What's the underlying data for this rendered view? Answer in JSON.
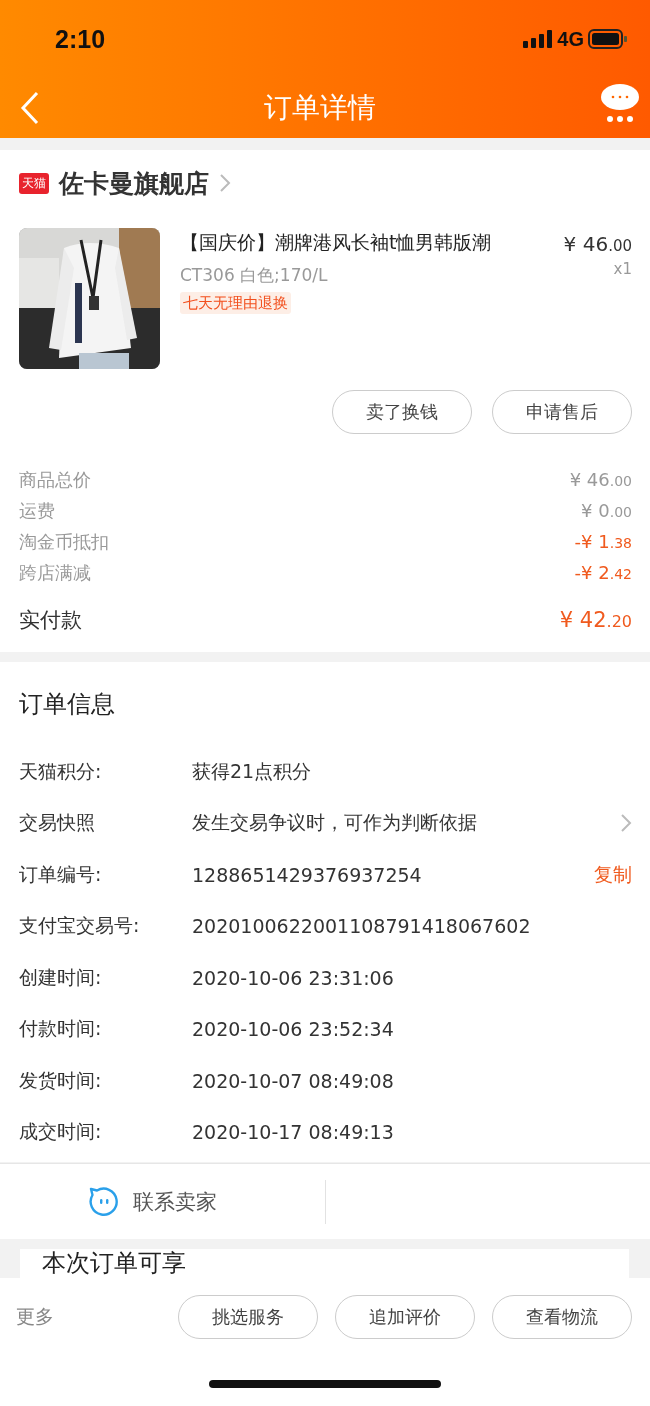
{
  "status_bar": {
    "time": "2:10",
    "network": "4G"
  },
  "nav": {
    "title": "订单详情"
  },
  "store": {
    "badge": "天猫",
    "name": "佐卡曼旗舰店"
  },
  "product": {
    "title": "【国庆价】潮牌港风长袖t恤男韩版潮",
    "sku": "CT306 白色;170/L",
    "tag": "七天无理由退换",
    "price": "¥ 46.00",
    "quantity": "x1"
  },
  "item_buttons": [
    "卖了换钱",
    "申请售后"
  ],
  "price_rows": [
    {
      "label": "商品总价",
      "value": "¥ 46.00",
      "discount": false
    },
    {
      "label": "运费",
      "value": "¥ 0.00",
      "discount": false
    },
    {
      "label": "淘金币抵扣",
      "value": "-¥ 1.38",
      "discount": true
    },
    {
      "label": "跨店满减",
      "value": "-¥ 2.42",
      "discount": true
    }
  ],
  "total": {
    "label": "实付款",
    "value": "¥ 42.20"
  },
  "order_info": {
    "title": "订单信息",
    "rows": [
      {
        "label": "天猫积分:",
        "value": "获得21点积分"
      },
      {
        "label": "交易快照",
        "value": "发生交易争议时，可作为判断依据",
        "kind": "chevron"
      },
      {
        "label": "订单编号:",
        "value": "1288651429376937254",
        "kind": "action",
        "action": "复制"
      },
      {
        "label": "支付宝交易号:",
        "value": "2020100622001108791418067602"
      },
      {
        "label": "创建时间:",
        "value": "2020-10-06 23:31:06"
      },
      {
        "label": "付款时间:",
        "value": "2020-10-06 23:52:34"
      },
      {
        "label": "发货时间:",
        "value": "2020-10-07 08:49:08"
      },
      {
        "label": "成交时间:",
        "value": "2020-10-17 08:49:13"
      }
    ]
  },
  "contact": {
    "label": "联系卖家"
  },
  "promo": {
    "title": "本次订单可享"
  },
  "bottom_bar": {
    "more": "更多",
    "buttons": [
      "挑选服务",
      "追加评价",
      "查看物流"
    ]
  }
}
